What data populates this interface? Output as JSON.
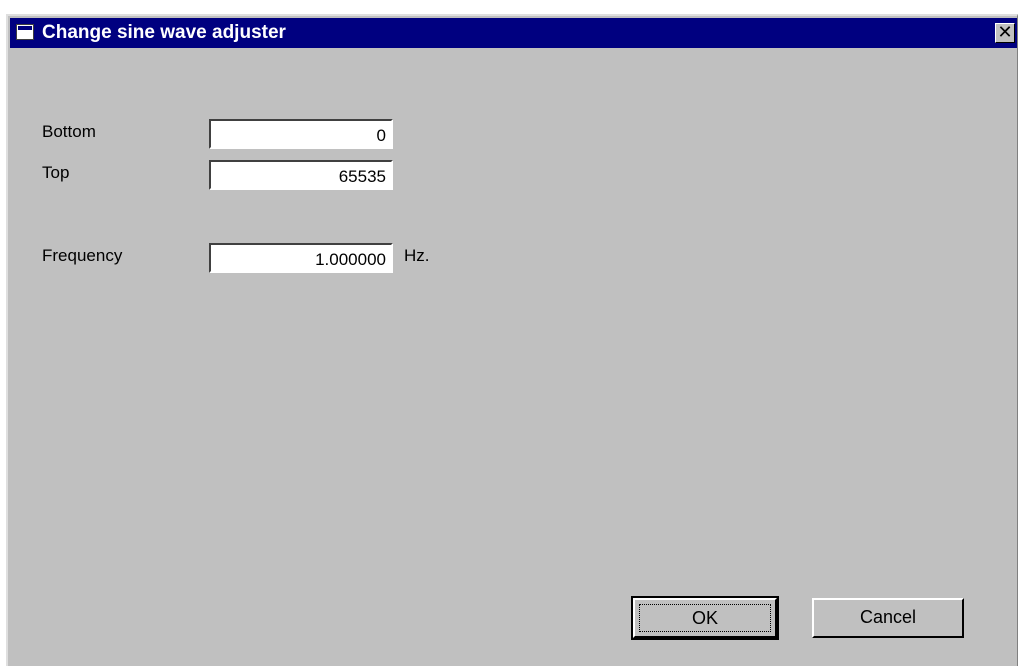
{
  "window": {
    "title": "Change sine wave adjuster",
    "close_glyph": "✕"
  },
  "form": {
    "bottom": {
      "label": "Bottom",
      "value": "0"
    },
    "top": {
      "label": "Top",
      "value": "65535"
    },
    "frequency": {
      "label": "Frequency",
      "value": "1.000000",
      "unit": "Hz."
    }
  },
  "buttons": {
    "ok": "OK",
    "cancel": "Cancel"
  },
  "colors": {
    "titlebar": "#000080",
    "face": "#c0c0c0"
  },
  "icons": {
    "window": "window-icon",
    "close": "close-icon"
  }
}
